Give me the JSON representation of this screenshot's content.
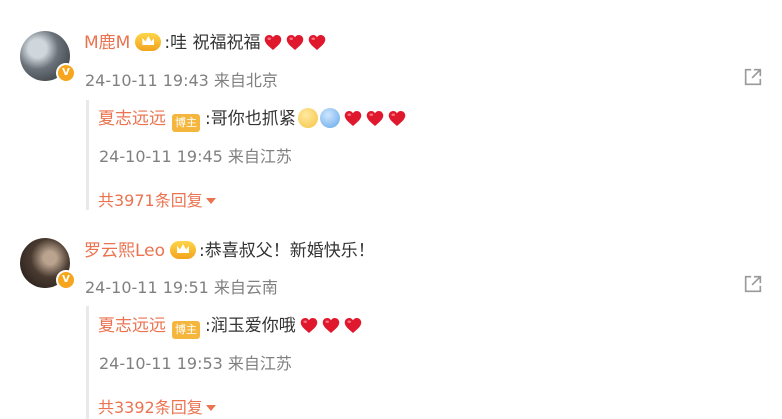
{
  "comments": [
    {
      "author": "M鹿M",
      "text": ":哇 祝福祝福",
      "time": "24-10-11 19:43",
      "location": "来自北京",
      "reply": {
        "author": "夏志远远",
        "badge": "博主",
        "text": ":哥你也抓紧",
        "time": "24-10-11 19:45",
        "location": "来自江苏"
      },
      "replies_count": "共3971条回复"
    },
    {
      "author": "罗云熙Leo",
      "text": ":恭喜叔父！新婚快乐！",
      "time": "24-10-11 19:51",
      "location": "来自云南",
      "reply": {
        "author": "夏志远远",
        "badge": "博主",
        "text": ":润玉爱你哦",
        "time": "24-10-11 19:53",
        "location": "来自江苏"
      },
      "replies_count": "共3392条回复"
    }
  ],
  "icons": {
    "avatar_badge": "vip-v-icon",
    "crown": "crown-icon",
    "heart": "heart-icon",
    "share": "share-icon",
    "expand": "caret-down-icon"
  },
  "colors": {
    "username": "#eb7350",
    "heart": "#e0182d",
    "meta": "#808080"
  }
}
